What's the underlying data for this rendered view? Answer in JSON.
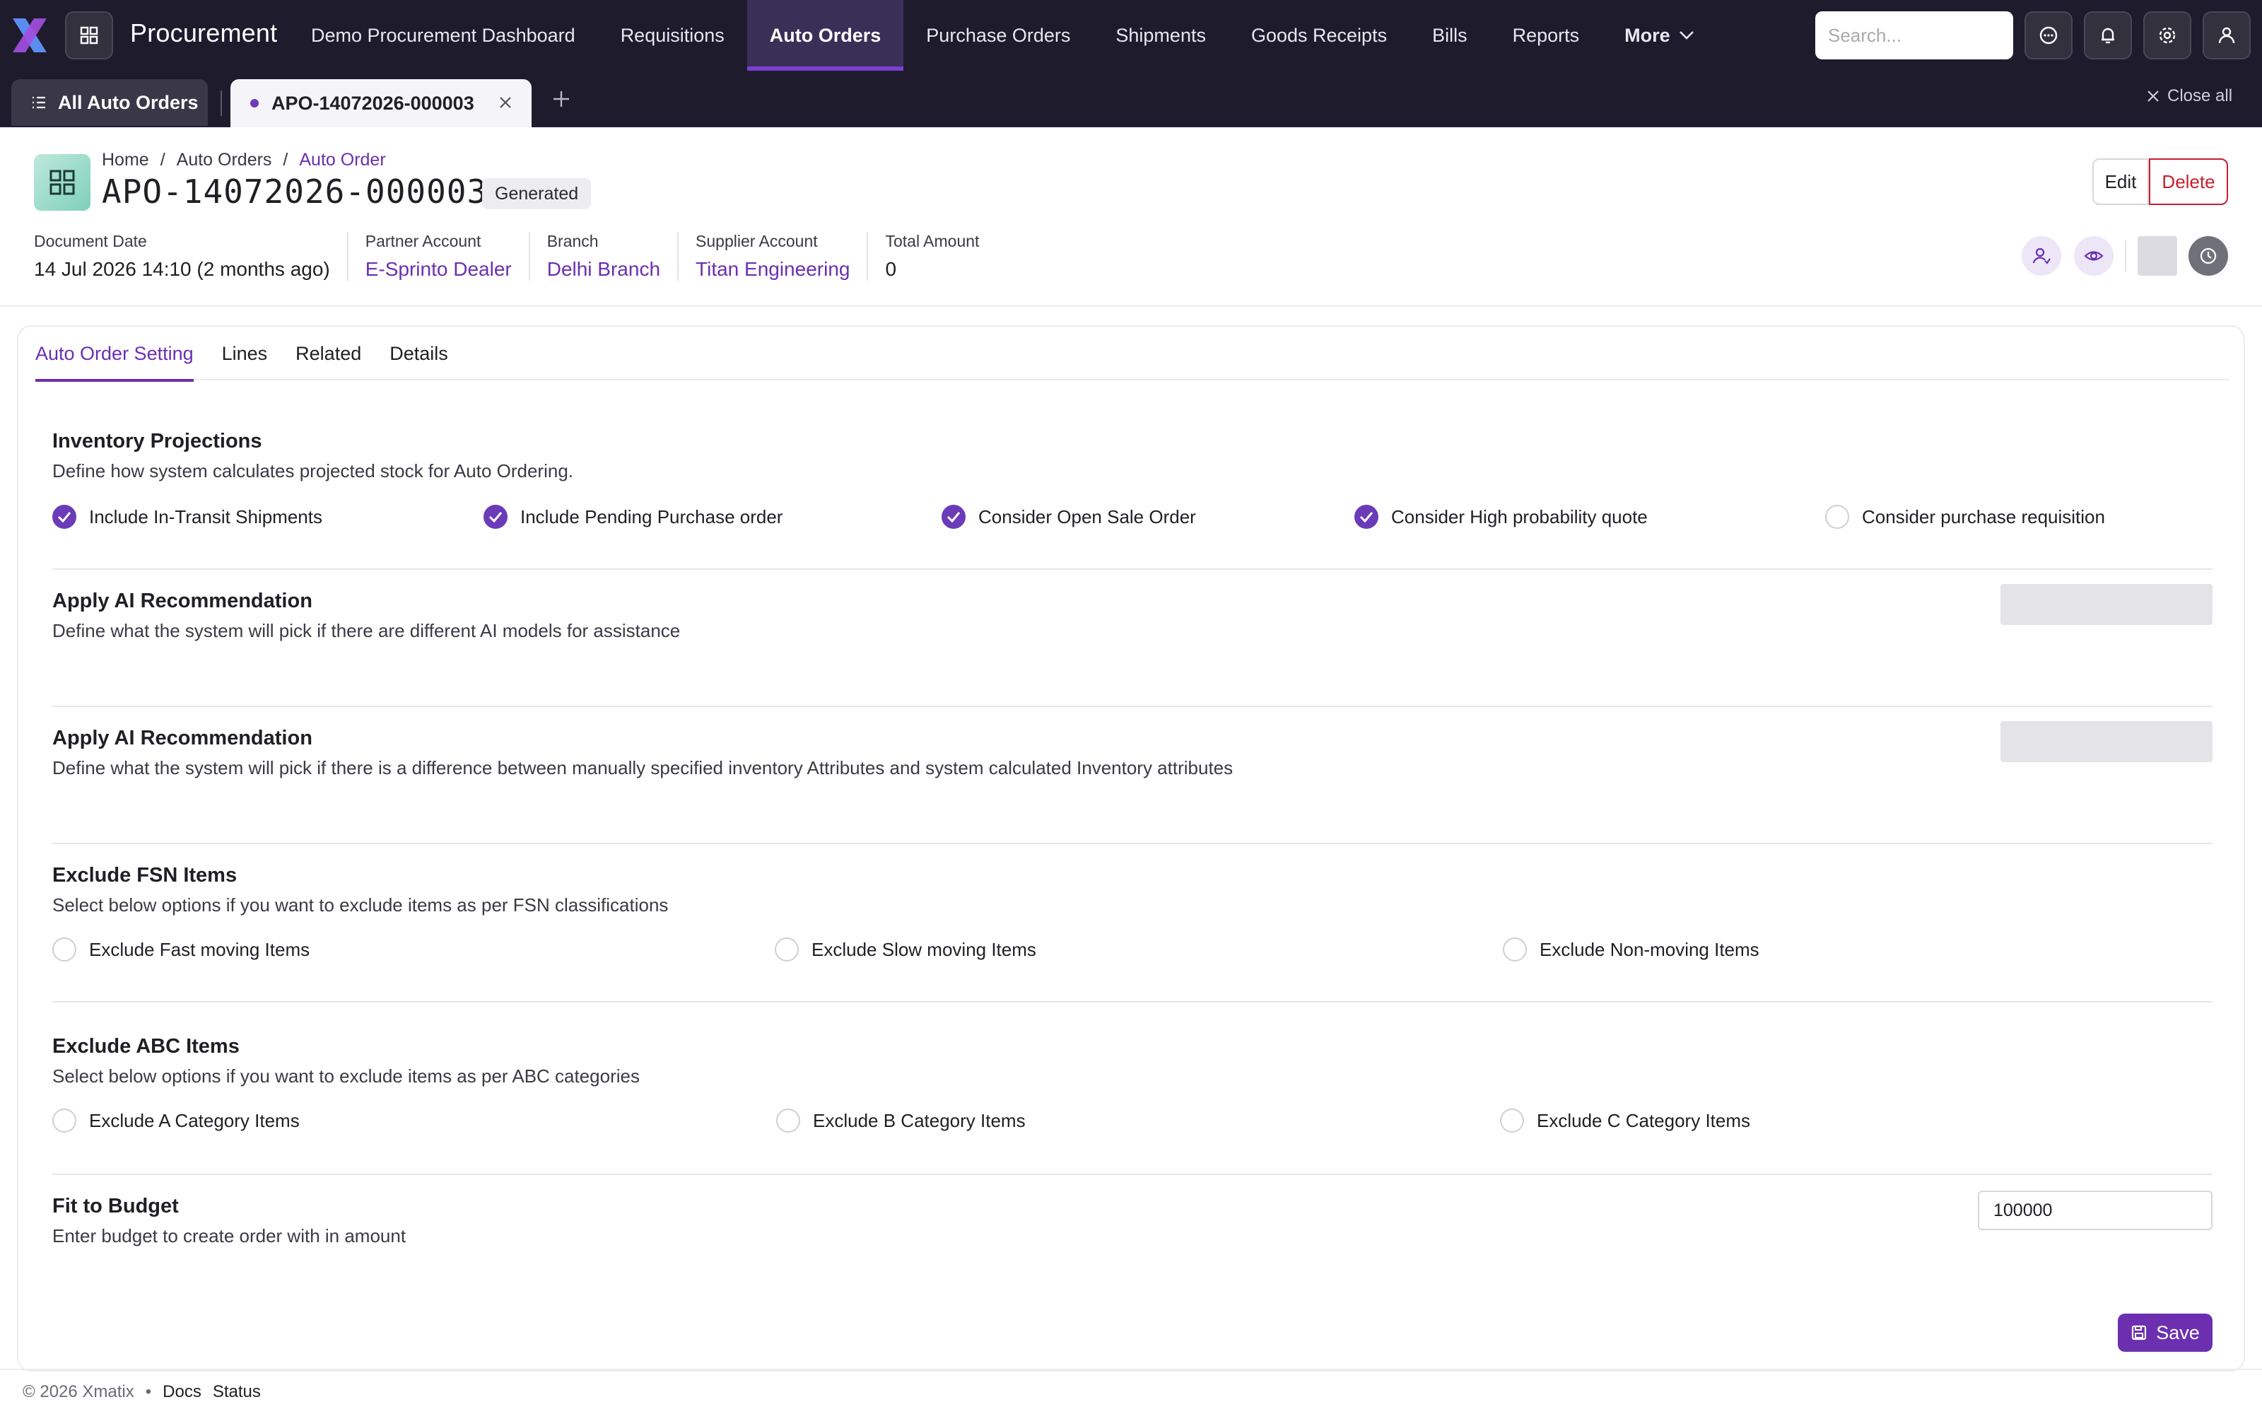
{
  "app": {
    "title": "Procurement",
    "accent_color": "#6b2fb0",
    "nav_bg": "#1e1b2d"
  },
  "nav": {
    "items": [
      {
        "label": "Demo Procurement Dashboard",
        "active": false
      },
      {
        "label": "Requisitions",
        "active": false
      },
      {
        "label": "Auto Orders",
        "active": true
      },
      {
        "label": "Purchase Orders",
        "active": false
      },
      {
        "label": "Shipments",
        "active": false
      },
      {
        "label": "Goods Receipts",
        "active": false
      },
      {
        "label": "Bills",
        "active": false
      },
      {
        "label": "Reports",
        "active": false
      }
    ],
    "more_label": "More",
    "search_placeholder": "Search...",
    "icons": [
      "search-icon",
      "chat-icon",
      "bell-icon",
      "gear-icon",
      "user-icon"
    ]
  },
  "tabstrip": {
    "all_label": "All Auto Orders",
    "doc_tab_label": "APO-14072026-000003",
    "close_all_label": "Close all"
  },
  "header": {
    "breadcrumb": [
      "Home",
      "Auto Orders",
      "Auto Order"
    ],
    "doc_number": "APO-14072026-000003",
    "status": "Generated",
    "edit_label": "Edit",
    "delete_label": "Delete",
    "meta": [
      {
        "label": "Document Date",
        "value": "14 Jul 2026 14:10 (2 months ago)",
        "link": false
      },
      {
        "label": "Partner Account",
        "value": "E-Sprinto Dealer",
        "link": true
      },
      {
        "label": "Branch",
        "value": "Delhi Branch",
        "link": true
      },
      {
        "label": "Supplier Account",
        "value": "Titan Engineering",
        "link": true
      },
      {
        "label": "Total Amount",
        "value": "0",
        "link": false
      }
    ]
  },
  "tabs": [
    {
      "label": "Auto Order Setting",
      "active": true
    },
    {
      "label": "Lines",
      "active": false
    },
    {
      "label": "Related",
      "active": false
    },
    {
      "label": "Details",
      "active": false
    }
  ],
  "sections": {
    "inventory": {
      "title": "Inventory Projections",
      "desc": "Define how system calculates projected stock for Auto Ordering.",
      "options": [
        {
          "label": "Include In-Transit Shipments",
          "checked": true
        },
        {
          "label": "Include Pending Purchase order",
          "checked": true
        },
        {
          "label": "Consider Open Sale Order",
          "checked": true
        },
        {
          "label": "Consider High probability quote",
          "checked": true
        },
        {
          "label": "Consider purchase requisition",
          "checked": false
        }
      ]
    },
    "ai1": {
      "title": "Apply AI Recommendation",
      "desc": "Define what the system will pick if there are different AI models for assistance"
    },
    "ai2": {
      "title": "Apply AI Recommendation",
      "desc": "Define what the system will pick if there is a difference between manually specified inventory Attributes and system calculated Inventory attributes"
    },
    "fsn": {
      "title": "Exclude FSN Items",
      "desc": "Select below options if you want to exclude items as per FSN classifications",
      "options": [
        {
          "label": "Exclude Fast moving Items",
          "checked": false
        },
        {
          "label": "Exclude Slow moving Items",
          "checked": false
        },
        {
          "label": "Exclude Non-moving Items",
          "checked": false
        }
      ]
    },
    "abc": {
      "title": "Exclude ABC Items",
      "desc": "Select below options if you want to exclude items as per ABC categories",
      "options": [
        {
          "label": "Exclude A Category Items",
          "checked": false
        },
        {
          "label": "Exclude B Category Items",
          "checked": false
        },
        {
          "label": "Exclude C Category Items",
          "checked": false
        }
      ]
    },
    "budget": {
      "title": "Fit to Budget",
      "desc": "Enter budget to create order with in amount",
      "value": "100000"
    }
  },
  "save_label": "Save",
  "footer": {
    "copyright": "© 2026 Xmatix",
    "separator": "•",
    "docs": "Docs",
    "status": "Status"
  }
}
